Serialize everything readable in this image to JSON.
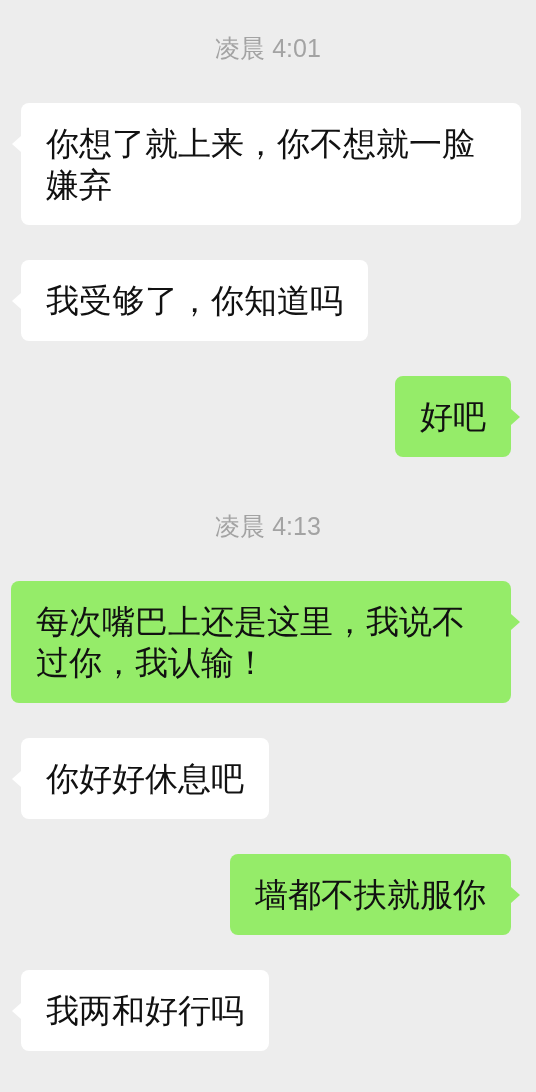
{
  "messages": [
    {
      "kind": "time",
      "text": "凌晨 4:01"
    },
    {
      "kind": "message",
      "outgoing": false,
      "text": "你想了就上来，你不想就一脸嫌弃"
    },
    {
      "kind": "message",
      "outgoing": false,
      "text": "我受够了，你知道吗"
    },
    {
      "kind": "message",
      "outgoing": true,
      "text": "好吧"
    },
    {
      "kind": "time",
      "text": "凌晨 4:13"
    },
    {
      "kind": "message",
      "outgoing": true,
      "text": "每次嘴巴上还是这里，我说不过你，我认输！"
    },
    {
      "kind": "message",
      "outgoing": false,
      "text": "你好好休息吧"
    },
    {
      "kind": "message",
      "outgoing": true,
      "text": "墙都不扶就服你"
    },
    {
      "kind": "message",
      "outgoing": false,
      "text": "我两和好行吗"
    }
  ]
}
